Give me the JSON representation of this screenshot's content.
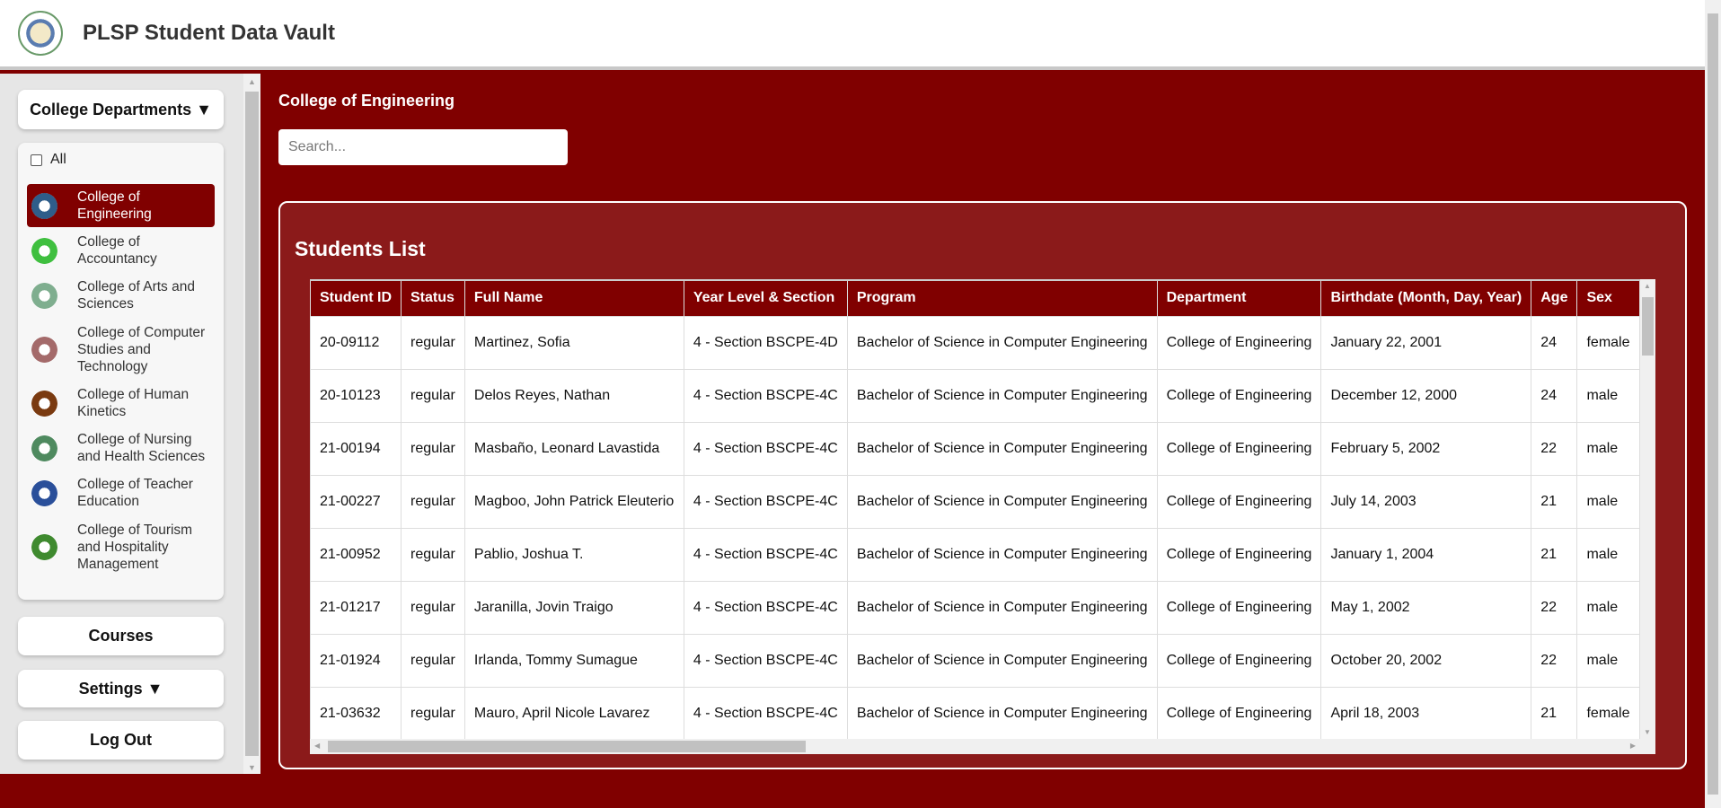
{
  "header": {
    "title": "PLSP Student Data Vault"
  },
  "sidebar": {
    "departments_button": "College Departments ▼",
    "all_label": "All",
    "departments": [
      {
        "label": "College of Engineering",
        "color": "#2f5d8a",
        "active": true
      },
      {
        "label": "College of Accountancy",
        "color": "#3fbf3f"
      },
      {
        "label": "College of Arts and Sciences",
        "color": "#7fae8f"
      },
      {
        "label": "College of Computer Studies and Technology",
        "color": "#a46a6a"
      },
      {
        "label": "College of Human Kinetics",
        "color": "#7a3a10"
      },
      {
        "label": "College of Nursing and Health Sciences",
        "color": "#4f8a5f"
      },
      {
        "label": "College of Teacher Education",
        "color": "#2a4f9a"
      },
      {
        "label": "College of Tourism and Hospitality Management",
        "color": "#3f8a2f"
      }
    ],
    "courses_button": "Courses",
    "settings_button": "Settings ▼",
    "logout_button": "Log Out"
  },
  "main": {
    "title": "College of Engineering",
    "search_placeholder": "Search...",
    "search_value": "",
    "card_title": "Students List",
    "columns": [
      "Student ID",
      "Status",
      "Full Name",
      "Year Level & Section",
      "Program",
      "Department",
      "Birthdate (Month, Day, Year)",
      "Age",
      "Sex"
    ],
    "rows": [
      [
        "20-09112",
        "regular",
        "Martinez, Sofia",
        "4 - Section BSCPE-4D",
        "Bachelor of Science in Computer Engineering",
        "College of Engineering",
        "January 22, 2001",
        "24",
        "female"
      ],
      [
        "20-10123",
        "regular",
        "Delos Reyes, Nathan",
        "4 - Section BSCPE-4C",
        "Bachelor of Science in Computer Engineering",
        "College of Engineering",
        "December 12, 2000",
        "24",
        "male"
      ],
      [
        "21-00194",
        "regular",
        "Masbaño, Leonard Lavastida",
        "4 - Section BSCPE-4C",
        "Bachelor of Science in Computer Engineering",
        "College of Engineering",
        "February 5, 2002",
        "22",
        "male"
      ],
      [
        "21-00227",
        "regular",
        "Magboo, John Patrick Eleuterio",
        "4 - Section BSCPE-4C",
        "Bachelor of Science in Computer Engineering",
        "College of Engineering",
        "July 14, 2003",
        "21",
        "male"
      ],
      [
        "21-00952",
        "regular",
        "Pablio, Joshua T.",
        "4 - Section BSCPE-4C",
        "Bachelor of Science in Computer Engineering",
        "College of Engineering",
        "January 1, 2004",
        "21",
        "male"
      ],
      [
        "21-01217",
        "regular",
        "Jaranilla, Jovin Traigo",
        "4 - Section BSCPE-4C",
        "Bachelor of Science in Computer Engineering",
        "College of Engineering",
        "May 1, 2002",
        "22",
        "male"
      ],
      [
        "21-01924",
        "regular",
        "Irlanda, Tommy Sumague",
        "4 - Section BSCPE-4C",
        "Bachelor of Science in Computer Engineering",
        "College of Engineering",
        "October 20, 2002",
        "22",
        "male"
      ],
      [
        "21-03632",
        "regular",
        "Mauro, April Nicole Lavarez",
        "4 - Section BSCPE-4C",
        "Bachelor of Science in Computer Engineering",
        "College of Engineering",
        "April 18, 2003",
        "21",
        "female"
      ]
    ]
  },
  "colors": {
    "brand": "#800000",
    "card": "#8b1a1a"
  }
}
